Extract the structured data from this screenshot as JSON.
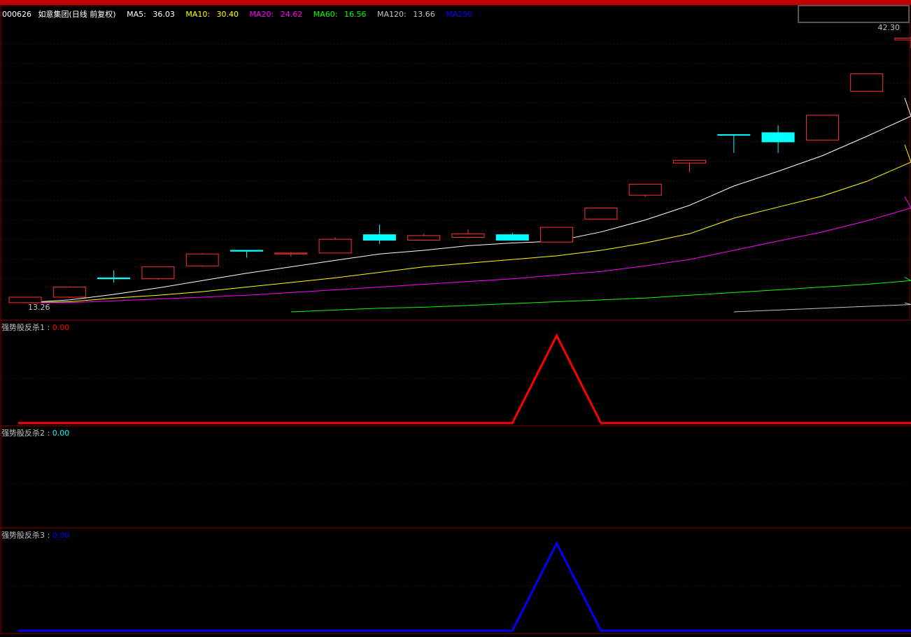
{
  "header": {
    "stock_code": "000626",
    "stock_name": "如意集团(日线 前复权)",
    "ma5_label": "MA5:",
    "ma5_value": "36.03",
    "ma10_label": "MA10:",
    "ma10_value": "30.40",
    "ma20_label": "MA20:",
    "ma20_value": "24.62",
    "ma60_label": "MA60:",
    "ma60_value": "16.56",
    "ma120_label": "MA120:",
    "ma120_value": "13.66",
    "ma250_label": "MA250",
    "ma250_value": "-"
  },
  "colors": {
    "up": "#ff3232",
    "down": "#00ffff",
    "ma5": "#ffffff",
    "ma10": "#ffff00",
    "ma20": "#ff00ff",
    "ma60": "#00ff00",
    "ma120": "#c0c0c0",
    "ma250": "#0000ff",
    "panel_border": "#800000",
    "grid": "#800000"
  },
  "price_labels": {
    "high": "42.30",
    "low": "13.26"
  },
  "panels": [
    {
      "name": "强势股反杀1",
      "value": "0.00",
      "color": "#ff0000"
    },
    {
      "name": "强势股反杀2",
      "value": "0.00",
      "color": "#00ffff"
    },
    {
      "name": "强势股反杀3",
      "value": "0.00",
      "color": "#0000ff"
    }
  ],
  "chart_data": [
    {
      "type": "candlestick",
      "title": "000626 如意集团(日线 前复权)",
      "ylim": [
        12.3,
        43.2
      ],
      "candles": [
        {
          "o": 13.3,
          "h": 13.9,
          "l": 13.3,
          "c": 13.9,
          "dir": "up"
        },
        {
          "o": 13.9,
          "h": 15.1,
          "l": 13.8,
          "c": 15.0,
          "dir": "up"
        },
        {
          "o": 16.0,
          "h": 16.8,
          "l": 15.5,
          "c": 15.9,
          "dir": "down"
        },
        {
          "o": 15.9,
          "h": 17.2,
          "l": 15.8,
          "c": 17.2,
          "dir": "up"
        },
        {
          "o": 17.3,
          "h": 18.7,
          "l": 17.2,
          "c": 18.6,
          "dir": "up"
        },
        {
          "o": 19.0,
          "h": 19.0,
          "l": 18.2,
          "c": 18.9,
          "dir": "down"
        },
        {
          "o": 18.6,
          "h": 18.8,
          "l": 18.3,
          "c": 18.7,
          "dir": "up"
        },
        {
          "o": 18.7,
          "h": 20.4,
          "l": 18.7,
          "c": 20.2,
          "dir": "up"
        },
        {
          "o": 20.7,
          "h": 21.8,
          "l": 19.7,
          "c": 20.1,
          "dir": "down"
        },
        {
          "o": 20.1,
          "h": 20.8,
          "l": 20.1,
          "c": 20.6,
          "dir": "up"
        },
        {
          "o": 20.4,
          "h": 21.3,
          "l": 20.3,
          "c": 20.8,
          "dir": "up"
        },
        {
          "o": 20.7,
          "h": 20.9,
          "l": 20.1,
          "c": 20.1,
          "dir": "down"
        },
        {
          "o": 19.9,
          "h": 21.5,
          "l": 19.9,
          "c": 21.5,
          "dir": "up"
        },
        {
          "o": 22.4,
          "h": 23.6,
          "l": 22.4,
          "c": 23.6,
          "dir": "up"
        },
        {
          "o": 25.0,
          "h": 26.2,
          "l": 24.8,
          "c": 26.2,
          "dir": "up"
        },
        {
          "o": 28.5,
          "h": 28.8,
          "l": 27.5,
          "c": 28.8,
          "dir": "up"
        },
        {
          "o": 31.6,
          "h": 31.6,
          "l": 29.6,
          "c": 31.6,
          "dir": "down"
        },
        {
          "o": 31.8,
          "h": 32.6,
          "l": 29.6,
          "c": 30.8,
          "dir": "down"
        },
        {
          "o": 31.0,
          "h": 33.7,
          "l": 31.0,
          "c": 33.7,
          "dir": "up"
        },
        {
          "o": 36.3,
          "h": 38.2,
          "l": 36.3,
          "c": 38.2,
          "dir": "up"
        },
        {
          "o": 41.9,
          "h": 42.3,
          "l": 41.0,
          "c": 42.1,
          "dir": "up"
        }
      ],
      "ma_series": [
        {
          "name": "MA5",
          "values": [
            13.3,
            13.6,
            14.2,
            14.9,
            15.7,
            16.5,
            17.2,
            17.9,
            18.6,
            19.0,
            19.5,
            19.8,
            20.0,
            21.0,
            22.3,
            23.9,
            26.0,
            27.6,
            29.3,
            31.4,
            33.6
          ]
        },
        {
          "name": "MA10",
          "values": [
            13.3,
            13.4,
            13.8,
            14.1,
            14.5,
            15.0,
            15.5,
            16.0,
            16.6,
            17.2,
            17.6,
            18.0,
            18.4,
            19.0,
            19.8,
            20.8,
            22.5,
            23.7,
            24.9,
            26.5,
            28.6
          ]
        },
        {
          "name": "MA20",
          "values": [
            13.3,
            13.3,
            13.5,
            13.7,
            13.9,
            14.1,
            14.4,
            14.7,
            15.0,
            15.3,
            15.6,
            15.9,
            16.3,
            16.7,
            17.3,
            18.0,
            19.0,
            20.0,
            21.0,
            22.2,
            23.6
          ]
        },
        {
          "name": "MA60",
          "values": [
            null,
            null,
            null,
            null,
            null,
            null,
            12.3,
            12.5,
            12.7,
            12.8,
            13.0,
            13.2,
            13.4,
            13.6,
            13.8,
            14.1,
            14.4,
            14.7,
            15.0,
            15.3,
            15.7
          ]
        },
        {
          "name": "MA120",
          "values": [
            null,
            null,
            null,
            null,
            null,
            null,
            null,
            null,
            null,
            null,
            null,
            null,
            null,
            null,
            null,
            null,
            12.3,
            12.5,
            12.7,
            12.9,
            13.1
          ]
        }
      ]
    },
    {
      "type": "line",
      "title": "强势股反杀1",
      "ylim": [
        0,
        1
      ],
      "values": [
        0,
        0,
        0,
        0,
        0,
        0,
        0,
        0,
        0,
        0,
        0,
        0,
        1,
        0,
        0,
        0,
        0,
        0,
        0,
        0,
        0
      ]
    },
    {
      "type": "line",
      "title": "强势股反杀2",
      "ylim": [
        0,
        1
      ],
      "values": []
    },
    {
      "type": "line",
      "title": "强势股反杀3",
      "ylim": [
        0,
        1
      ],
      "values": [
        0,
        0,
        0,
        0,
        0,
        0,
        0,
        0,
        0,
        0,
        0,
        0,
        1,
        0,
        0,
        0,
        0,
        0,
        0,
        0,
        0
      ]
    }
  ]
}
